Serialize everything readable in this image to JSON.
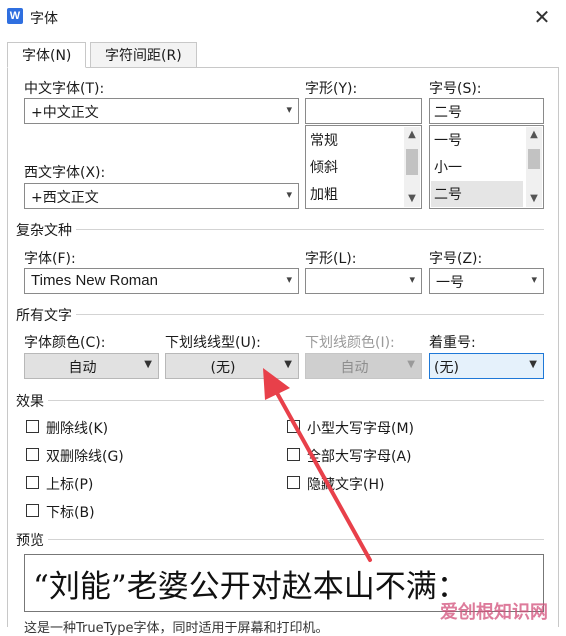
{
  "window": {
    "title": "字体",
    "app_icon_letter": "W"
  },
  "tabs": [
    {
      "label": "字体(N)"
    },
    {
      "label": "字符间距(R)"
    }
  ],
  "font": {
    "cn_font_label": "中文字体(T):",
    "cn_font_value": "+中文正文",
    "western_font_label": "西文字体(X):",
    "western_font_value": "+西文正文",
    "style_label": "字形(Y):",
    "style_value": "",
    "style_options": [
      "常规",
      "倾斜",
      "加粗"
    ],
    "size_label": "字号(S):",
    "size_value": "二号",
    "size_options": [
      "一号",
      "小一",
      "二号"
    ],
    "size_selected": "二号"
  },
  "complex": {
    "section": "复杂文种",
    "font_label": "字体(F):",
    "font_value": "Times New Roman",
    "style_label": "字形(L):",
    "style_value": "",
    "size_label": "字号(Z):",
    "size_value": "一号"
  },
  "all_text": {
    "section": "所有文字",
    "color_label": "字体颜色(C):",
    "color_value": "自动",
    "underline_type_label": "下划线线型(U):",
    "underline_type_value": "(无)",
    "underline_color_label": "下划线颜色(I):",
    "underline_color_value": "自动",
    "emphasis_label": "着重号:",
    "emphasis_value": "(无)"
  },
  "effects": {
    "section": "效果",
    "items": [
      {
        "label": "删除线(K)",
        "checked": false
      },
      {
        "label": "双删除线(G)",
        "checked": false
      },
      {
        "label": "上标(P)",
        "checked": false
      },
      {
        "label": "下标(B)",
        "checked": false
      },
      {
        "label": "小型大写字母(M)",
        "checked": false
      },
      {
        "label": "全部大写字母(A)",
        "checked": false
      },
      {
        "label": "隐藏文字(H)",
        "checked": false
      }
    ]
  },
  "preview": {
    "section": "预览",
    "text": "“刘能”老婆公开对赵本山不满：",
    "note": "这是一种TrueType字体，同时适用于屏幕和打印机。"
  },
  "watermark": "爱创根知识网",
  "colors": {
    "annotation_arrow": "#e8404a",
    "focus_border": "#1e78d7"
  },
  "icons": {
    "close": "close-icon",
    "dropdown": "chevron-down-icon",
    "checkbox": "checkbox-icon"
  }
}
